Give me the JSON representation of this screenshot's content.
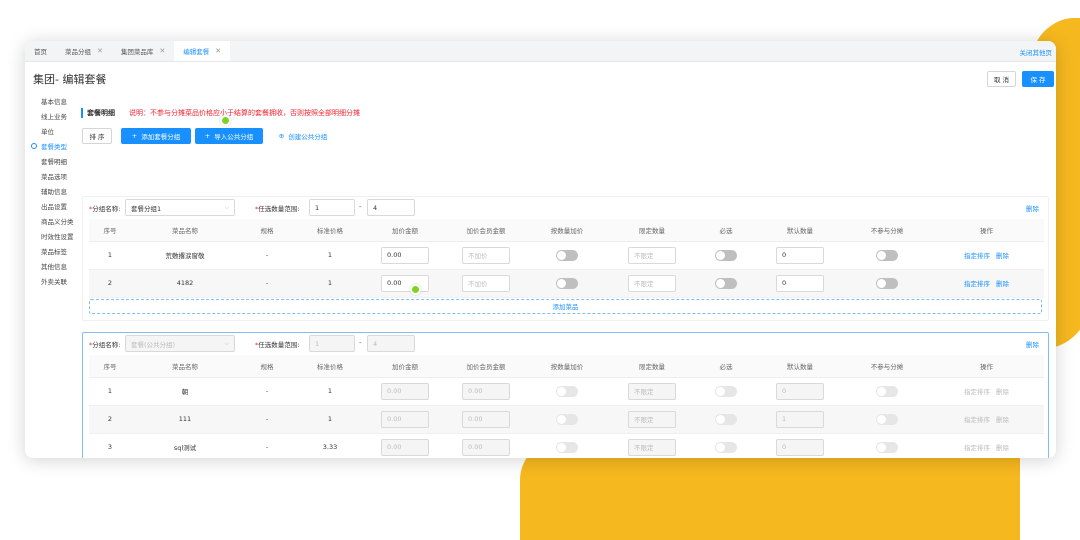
{
  "tabs": [
    {
      "label": "首页",
      "closable": false
    },
    {
      "label": "菜品分组",
      "closable": true
    },
    {
      "label": "集团菜品库",
      "closable": true
    },
    {
      "label": "编辑套餐",
      "closable": true,
      "active": true
    }
  ],
  "close_other": "关闭其他页",
  "page_title": "集团- 编辑套餐",
  "actions": {
    "cancel": "取 消",
    "save": "保 存"
  },
  "sidebar": [
    "基本信息",
    "线上业务",
    "单位",
    "套餐类型",
    "套餐明细",
    "菜品选项",
    "辅助信息",
    "出品设置",
    "商品义分类",
    "时效性设置",
    "菜品标签",
    "其他信息",
    "外卖关联"
  ],
  "sidebar_active": 3,
  "section": {
    "title": "套餐明细",
    "warning": "说明：不参与分摊菜品价格应小于结算的套餐拥收，否则按照全部明细分摊"
  },
  "controls": {
    "sort": "排 序",
    "add_group": "添加套餐分组",
    "import_group": "导入公共分组",
    "create_group": "创建公共分组"
  },
  "columns": [
    "序号",
    "菜品名称",
    "规格",
    "标准价格",
    "加价金额",
    "加价会员金额",
    "按数量加价",
    "限定数量",
    "必选",
    "默认数量",
    "不参与分摊",
    "操作"
  ],
  "labels": {
    "group_name": "分组名称:",
    "qty_range": "任选数量范围:",
    "delete": "删除",
    "add_dish": "添加菜品",
    "row_sort": "指定排序",
    "row_delete": "删除"
  },
  "groups": [
    {
      "name": "套餐分组1",
      "range_from": "1",
      "range_to": "4",
      "disabled": false,
      "rows": [
        {
          "no": "1",
          "name": "荒敷撂涙窗敬",
          "spec": "-",
          "price": "1",
          "markup": "0.00",
          "member_markup": "不加价",
          "limit": "不限定",
          "default_qty": "0"
        },
        {
          "no": "2",
          "name": "4182",
          "spec": "-",
          "price": "1",
          "markup": "0.00",
          "member_markup": "不加价",
          "limit": "不限定",
          "default_qty": "0"
        }
      ]
    },
    {
      "name": "套餐(公共分组)",
      "range_from": "1",
      "range_to": "4",
      "disabled": true,
      "rows": [
        {
          "no": "1",
          "name": "朝",
          "spec": "-",
          "price": "1",
          "markup": "0.00",
          "member_markup": "0.00",
          "limit": "不限定",
          "default_qty": "0"
        },
        {
          "no": "2",
          "name": "111",
          "spec": "-",
          "price": "1",
          "markup": "0.00",
          "member_markup": "0.00",
          "limit": "不限定",
          "default_qty": "1"
        },
        {
          "no": "3",
          "name": "sql测试",
          "spec": "-",
          "price": "3.33",
          "markup": "0.00",
          "member_markup": "0.00",
          "limit": "不限定",
          "default_qty": "0"
        }
      ]
    }
  ],
  "colors": {
    "primary": "#1890ff",
    "danger": "#f5222d",
    "accent_yellow": "#f6b81f",
    "pin_green": "#7ed321"
  }
}
